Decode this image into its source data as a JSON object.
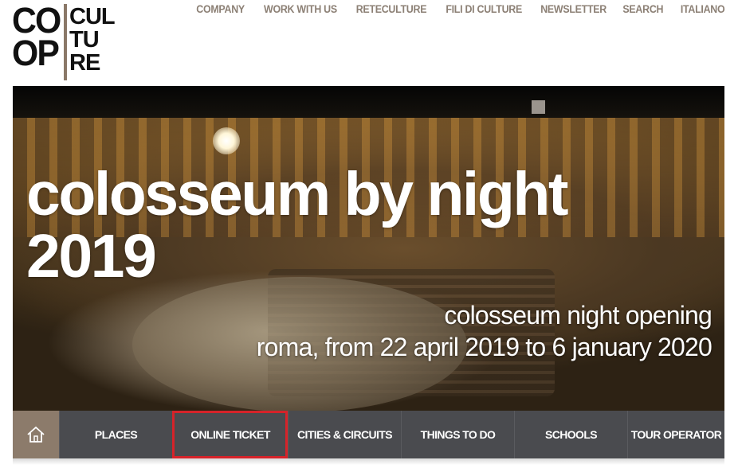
{
  "logo": {
    "left_lines": [
      "CO",
      "OP"
    ],
    "right_lines": [
      "CUL",
      "TU",
      "RE"
    ]
  },
  "topnav": [
    "COMPANY",
    "WORK WITH US",
    "RETECULTURE",
    "FILI DI CULTURE",
    "NEWSLETTER",
    "SEARCH",
    "ITALIANO"
  ],
  "hero": {
    "title_lines": [
      "colosseum by night",
      "2019"
    ],
    "subtitle_lines": [
      "colosseum night opening",
      "roma, from 22 april 2019 to 6 january 2020"
    ]
  },
  "mainnav": {
    "home_icon": "home-icon",
    "items": [
      "PLACES",
      "ONLINE TICKET",
      "CITIES & CIRCUITS",
      "THINGS TO DO",
      "SCHOOLS",
      "TOUR OPERATOR"
    ],
    "selected": "ONLINE TICKET"
  },
  "colors": {
    "nav_bg": "#4a4b4f",
    "home_bg": "#8c7b6b",
    "topnav_text": "#8c8075",
    "highlight": "#d6232a"
  }
}
